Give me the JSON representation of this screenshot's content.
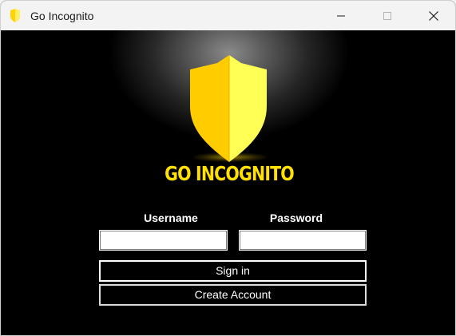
{
  "window": {
    "title": "Go Incognito",
    "icon": "shield-icon"
  },
  "controls": {
    "minimize_icon": "minimize-icon",
    "maximize_icon": "maximize-icon",
    "close_icon": "close-icon"
  },
  "logo": {
    "name": "GO INCOGNITO",
    "icon": "shield-icon",
    "accent": "#ffe000"
  },
  "form": {
    "username_label": "Username",
    "username_value": "",
    "password_label": "Password",
    "password_value": "",
    "signin_label": "Sign in",
    "create_label": "Create Account"
  }
}
